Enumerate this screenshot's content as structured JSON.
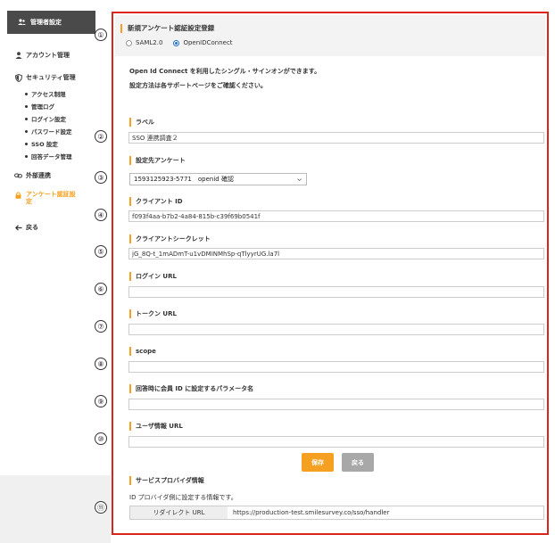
{
  "sidebar": {
    "header": "管理者設定",
    "items": [
      {
        "label": "アカウント管理",
        "icon": "user-icon"
      },
      {
        "label": "セキュリティ管理",
        "icon": "shield-icon"
      }
    ],
    "security_sub": [
      "アクセス制限",
      "管理ログ",
      "ログイン設定",
      "パスワード設定",
      "SSO 設定",
      "回答データ管理"
    ],
    "external": "外部連携",
    "survey_auth_line1": "アンケート認証設",
    "survey_auth_line2": "定",
    "back": "戻る"
  },
  "form": {
    "title": "新規アンケート認証設定登録",
    "radio_saml": "SAML2.0",
    "radio_oidc": "OpenIDConnect",
    "desc1": "Open Id Connect を利用したシングル・サインオンができます。",
    "desc2": "設定方法は各サポートページをご確認ください。",
    "label_label": "ラベル",
    "label_value": "SSO 連携調査２",
    "target_label": "設定先アンケート",
    "target_value": "1593125923-5771　openid 確認",
    "client_id_label": "クライアント ID",
    "client_id_value": "f093f4aa-b7b2-4a84-815b-c39f69b0541f",
    "client_secret_label": "クライアントシークレット",
    "client_secret_value": "jG_8Q-t_1mADmT-u1vDMINMhSp-qTlyyrUG.la7l",
    "login_url_label": "ログイン URL",
    "token_url_label": "トークン URL",
    "scope_label": "scope",
    "member_param_label": "回答時に会員 ID に設定するパラメータ名",
    "userinfo_url_label": "ユーザ情報 URL",
    "save": "保存",
    "back": "戻る",
    "sp_title": "サービスプロバイダ情報",
    "sp_desc": "ID プロバイダ側に設定する情報です。",
    "redirect_key": "リダイレクト URL",
    "redirect_value": "https://production-test.smilesurvey.co/sso/handler"
  },
  "markers": [
    "①",
    "②",
    "③",
    "④",
    "⑤",
    "⑥",
    "⑦",
    "⑧",
    "⑨",
    "⑩",
    "⑪"
  ],
  "colors": {
    "accent": "#f5a020",
    "frame": "#d9251c",
    "radio": "#2a6ed1"
  }
}
